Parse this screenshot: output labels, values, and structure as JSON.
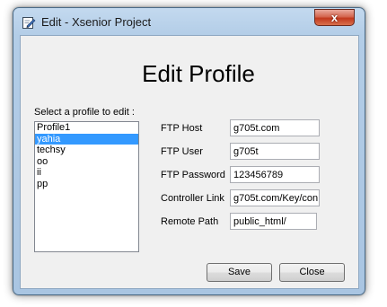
{
  "window": {
    "title": "Edit - Xsenior Project",
    "close_glyph": "x"
  },
  "heading": "Edit Profile",
  "profile_list": {
    "label": "Select a profile to edit :",
    "items": [
      "Profile1",
      "yahia",
      "techsy",
      "oo",
      "ii",
      "pp"
    ],
    "selected": "yahia"
  },
  "fields": {
    "ftp_host": {
      "label": "FTP Host",
      "value": "g705t.com"
    },
    "ftp_user": {
      "label": "FTP User",
      "value": "g705t"
    },
    "ftp_password": {
      "label": "FTP Password",
      "value": "123456789"
    },
    "controller_link": {
      "label": "Controller Link",
      "value": "g705t.com/Key/con"
    },
    "remote_path": {
      "label": "Remote Path",
      "value": "public_html/"
    }
  },
  "buttons": {
    "save": "Save",
    "close": "Close"
  },
  "colors": {
    "selection": "#3399ff",
    "titlebar": "#b3cde7",
    "close_button": "#c2391e"
  },
  "icons": {
    "title": "edit-pencil-icon"
  }
}
